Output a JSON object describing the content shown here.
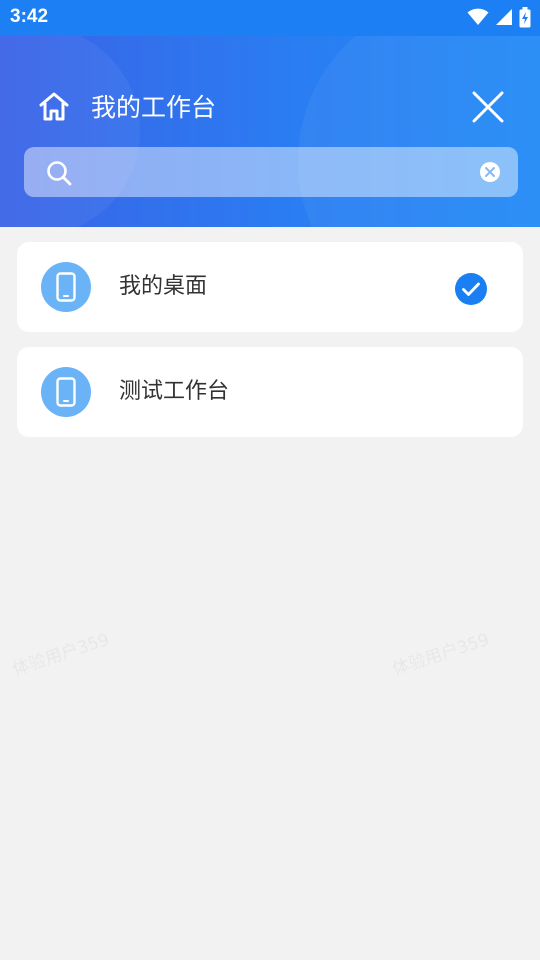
{
  "status_bar": {
    "time": "3:42",
    "icons": [
      "wifi-icon",
      "signal-icon",
      "battery-charging-icon"
    ]
  },
  "header": {
    "title": "我的工作台",
    "home_icon": "home-icon",
    "close_icon": "close-icon"
  },
  "search": {
    "value": "",
    "placeholder": "",
    "search_icon": "search-icon",
    "clear_icon": "clear-icon"
  },
  "workspaces": [
    {
      "label": "我的桌面",
      "icon": "phone-icon",
      "selected": true
    },
    {
      "label": "测试工作台",
      "icon": "phone-icon",
      "selected": false
    }
  ],
  "watermark": {
    "text": "体验用户359"
  },
  "colors": {
    "header_start": "#3a63e6",
    "header_end": "#2189f6",
    "avatar": "#6ab3f7",
    "check": "#1a7ff2",
    "background": "#f2f2f2"
  }
}
